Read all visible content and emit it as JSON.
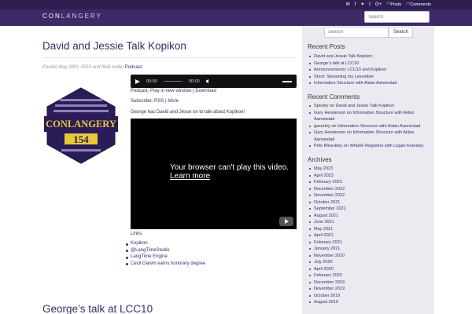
{
  "header": {
    "logo_prefix": "CON",
    "logo_suffix": "LANGERY",
    "search_placeholder": "Search",
    "social": {
      "posts_label": "Posts",
      "comments_label": "Comments"
    }
  },
  "post": {
    "title": "David and Jessie Talk Kopikon",
    "meta_prefix": "Posted May 28th, 2023 and filed under",
    "category": "Podcast",
    "audio": {
      "time_current": "00:00",
      "time_total": "00:00"
    },
    "podcast_label": "Podcast: ",
    "play_new_window": "Play in new window",
    "separator": " | ",
    "download": "Download",
    "subscribe_label": "Subscribe: ",
    "rss": "RSS",
    "more": "More",
    "description": "George has David and Jesse on to talk about Kopikon!",
    "video": {
      "message": "Your browser can't play this video.",
      "learn_more": "Learn more"
    },
    "badge": {
      "title": "CONLANGERY",
      "number": "154"
    },
    "links_label": "Links:",
    "links": [
      "Kopikon",
      "@LangTimeStudio",
      "LangTime Engine",
      "Cecil Garvin earns honorary degree"
    ]
  },
  "post2": {
    "title": "George’s talk at LCC10"
  },
  "sidebar": {
    "search_placeholder": "Search",
    "search_button": "Search",
    "recent_posts_title": "Recent Posts",
    "recent_posts": [
      "David and Jessie Talk Kopikon",
      "George’s talk at LCC10",
      "Announcements: LCC10 and Kopikon",
      "Short: Streaming my Lexember",
      "Information Structure with Aidan Aannestad"
    ],
    "recent_comments_title": "Recent Comments",
    "recent_comments": [
      {
        "author": "Spooky",
        "on": " on ",
        "post": "David and Jessie Talk Kopikon"
      },
      {
        "author": "Gary Henderson",
        "on": " on ",
        "post": "Information Structure with Aidan Aannestad"
      },
      {
        "author": "gacorley",
        "on": " on ",
        "post": "Information Structure with Aidan Aannestad"
      },
      {
        "author": "Gary Henderson",
        "on": " on ",
        "post": "Information Structure with Aidan Aannestad"
      },
      {
        "author": "Pete Bleackley",
        "on": " on ",
        "post": "Whistle Registers with Logan Kearsley"
      }
    ],
    "archives_title": "Archives",
    "archives": [
      "May 2023",
      "April 2023",
      "February 2023",
      "December 2022",
      "November 2022",
      "October 2021",
      "September 2021",
      "August 2021",
      "June 2021",
      "May 2021",
      "April 2021",
      "February 2021",
      "January 2021",
      "November 2020",
      "July 2020",
      "April 2020",
      "February 2020",
      "December 2019",
      "November 2019",
      "October 2019",
      "August 2019"
    ]
  }
}
